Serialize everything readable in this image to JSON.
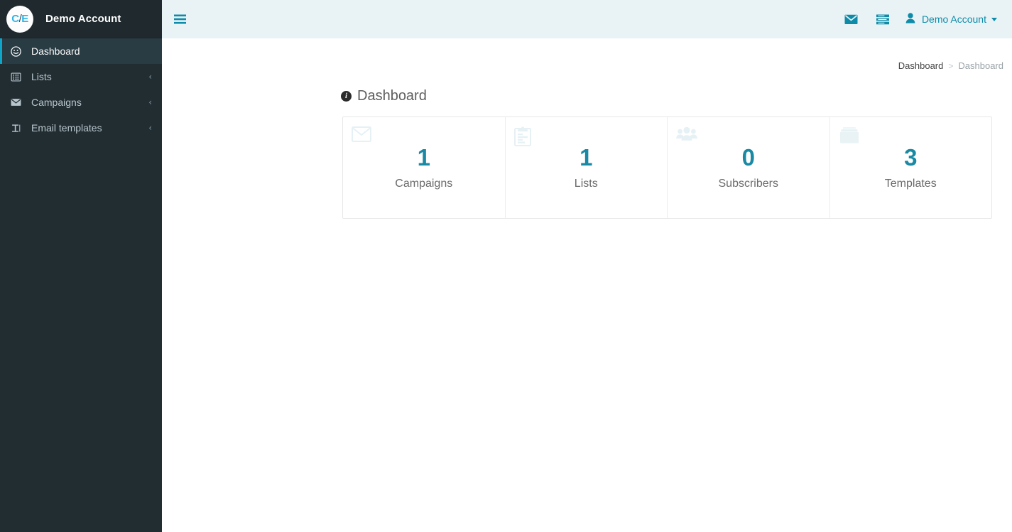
{
  "colors": {
    "sidebar_bg": "#222d32",
    "sidebar_brand_bg": "#1f292e",
    "active_accent": "#0fa4c9",
    "topbar_bg": "#e9f3f6",
    "teal": "#0e8ba8",
    "stat_number": "#1a89a4",
    "stat_icon": "#eaf3f6"
  },
  "sidebar": {
    "logo_parts": {
      "left": "C",
      "slash": "/",
      "right": "E"
    },
    "logo_icon": "ce-circle-logo",
    "brand_title": "Demo Account",
    "items": [
      {
        "label": "Dashboard",
        "icon": "dashboard-icon",
        "active": true,
        "chevron": ""
      },
      {
        "label": "Lists",
        "icon": "list-alt-icon",
        "active": false,
        "chevron": "‹"
      },
      {
        "label": "Campaigns",
        "icon": "envelope-icon",
        "active": false,
        "chevron": "‹"
      },
      {
        "label": "Email templates",
        "icon": "text-height-icon",
        "active": false,
        "chevron": "‹"
      }
    ]
  },
  "topbar": {
    "menu_toggle_icon": "hamburger-icon",
    "icons": [
      {
        "name": "envelope-icon",
        "label": "Messages"
      },
      {
        "name": "tasks-icon",
        "label": "Tasks"
      }
    ],
    "user": {
      "icon": "user-icon",
      "name": "Demo Account",
      "caret_icon": "caret-down-icon"
    }
  },
  "breadcrumb": {
    "root": "Dashboard",
    "separator": ">",
    "current": "Dashboard"
  },
  "page": {
    "info_icon": "info-circle-icon",
    "info_glyph": "i",
    "title": "Dashboard"
  },
  "stats": [
    {
      "value": "1",
      "label": "Campaigns",
      "icon": "envelope-open-icon"
    },
    {
      "value": "1",
      "label": "Lists",
      "icon": "clipboard-list-icon"
    },
    {
      "value": "0",
      "label": "Subscribers",
      "icon": "users-icon"
    },
    {
      "value": "3",
      "label": "Templates",
      "icon": "clone-files-icon"
    }
  ]
}
